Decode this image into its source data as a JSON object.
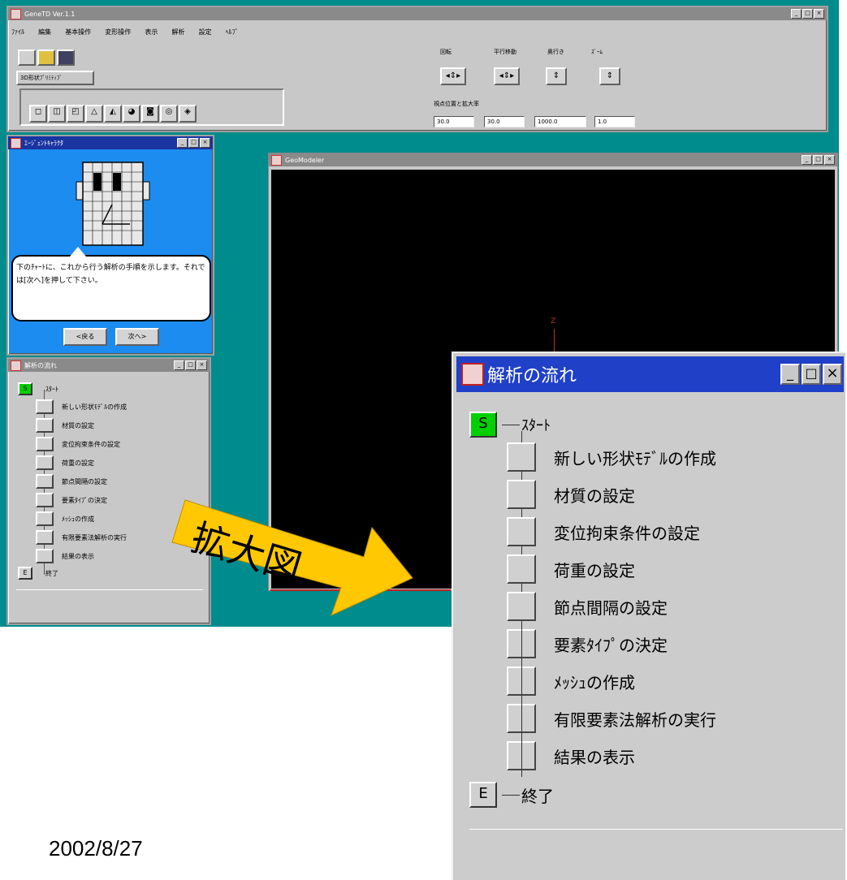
{
  "main_window": {
    "title": "GeneTD Ver.1.1",
    "menu": [
      "ﾌｧｲﾙ",
      "編集",
      "基本操作",
      "変形操作",
      "表示",
      "解析",
      "設定",
      "ﾍﾙﾌﾟ"
    ],
    "tab_label": "3D形状ﾌﾟﾘﾐﾃｨﾌﾞ",
    "view_groups": [
      {
        "label": "回転",
        "arrows": "◂⇕▸"
      },
      {
        "label": "平行移動",
        "arrows": "◂⇕▸"
      },
      {
        "label": "奥行き",
        "arrows": "⇕"
      },
      {
        "label": "ｽﾞｰﾑ",
        "arrows": "⇕"
      }
    ],
    "viewpoint_label": "視点位置と拡大率",
    "viewpoint_values": [
      "30.0",
      "30.0",
      "1000.0",
      "1.0"
    ]
  },
  "agent_window": {
    "title": "ｴｰｼﾞｪﾝﾄｷｬﾗｸﾀ",
    "message": "下のﾁｬｰﾄに、これから行う解析の手順を示します。それでは[次へ]を押して下さい。",
    "back_button": "<戻る",
    "next_button": "次へ>"
  },
  "geomodeler_window": {
    "title": "GeoModeler",
    "axis_label": "Z"
  },
  "flow": {
    "title": "解析の流れ",
    "start_button": "S",
    "start_label": "ｽﾀｰﾄ",
    "steps": [
      "新しい形状ﾓﾃﾞﾙの作成",
      "材質の設定",
      "変位拘束条件の設定",
      "荷重の設定",
      "節点間隔の設定",
      "要素ﾀｲﾌﾟの決定",
      "ﾒｯｼｭの作成",
      "有限要素法解析の実行",
      "結果の表示"
    ],
    "end_button": "E",
    "end_label": "終了"
  },
  "callout_label": "拡大図",
  "date": "2002/8/27"
}
